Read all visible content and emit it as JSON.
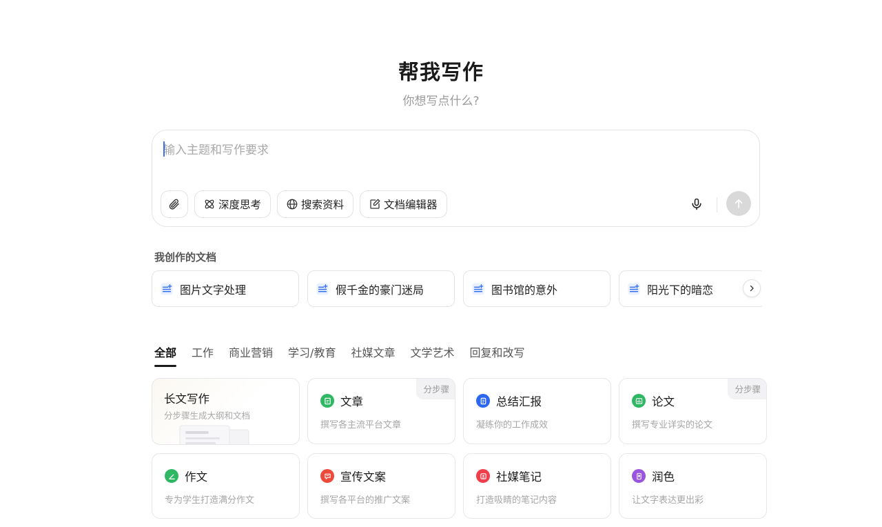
{
  "header": {
    "title": "帮我写作",
    "subtitle": "你想写点什么?"
  },
  "composer": {
    "placeholder": "输入主题和写作要求",
    "tools": [
      {
        "label": "深度思考",
        "icon": "atom-icon"
      },
      {
        "label": "搜索资料",
        "icon": "globe-icon"
      },
      {
        "label": "文档编辑器",
        "icon": "edit-doc-icon"
      }
    ]
  },
  "my_docs": {
    "label": "我创作的文档",
    "items": [
      "图片文字处理",
      "假千金的豪门迷局",
      "图书馆的意外",
      "阳光下的暗恋"
    ]
  },
  "tabs": [
    "全部",
    "工作",
    "商业营销",
    "学习/教育",
    "社媒文章",
    "文学艺术",
    "回复和改写"
  ],
  "templates": [
    {
      "name": "长文写作",
      "desc": "分步骤生成大纲和文档"
    },
    {
      "name": "文章",
      "desc": "撰写各主流平台文章",
      "tag": "分步骤",
      "color": "#2fb864"
    },
    {
      "name": "总结汇报",
      "desc": "凝练你的工作成效",
      "color": "#2b67f0"
    },
    {
      "name": "论文",
      "desc": "撰写专业详实的论文",
      "tag": "分步骤",
      "color": "#2fb864"
    },
    {
      "name": "作文",
      "desc": "专为学生打造满分作文",
      "color": "#2fb864"
    },
    {
      "name": "宣传文案",
      "desc": "撰写各平台的推广文案",
      "color": "#ee4a3c"
    },
    {
      "name": "社媒笔记",
      "desc": "打造吸睛的笔记内容",
      "color": "#f23d4b"
    },
    {
      "name": "润色",
      "desc": "让文字表达更出彩",
      "color": "#9a55e0"
    }
  ]
}
